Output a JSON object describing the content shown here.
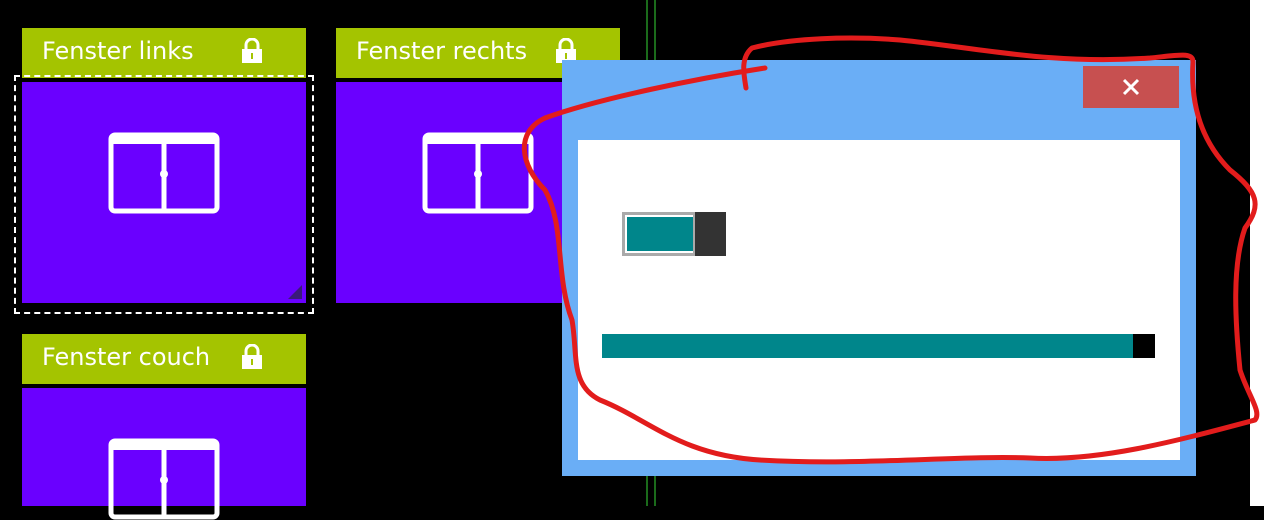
{
  "tiles": [
    {
      "label": "Fenster links",
      "icon": "window-icon",
      "status_icon": "lock-icon",
      "focused": true
    },
    {
      "label": "Fenster rechts",
      "icon": "window-icon",
      "status_icon": "lock-icon",
      "focused": false
    },
    {
      "label": "Fenster couch",
      "icon": "window-icon",
      "status_icon": "lock-icon",
      "focused": false
    }
  ],
  "dialog": {
    "close_icon": "close-icon",
    "toggle_on": true,
    "slider_value_fraction": 0.96
  },
  "colors": {
    "tile_header": "#a4c400",
    "tile_body": "#6a00ff",
    "dialog_frame": "#6aaef6",
    "close_button": "#c75050",
    "accent": "#00868b",
    "annotation": "#e21c1c"
  }
}
